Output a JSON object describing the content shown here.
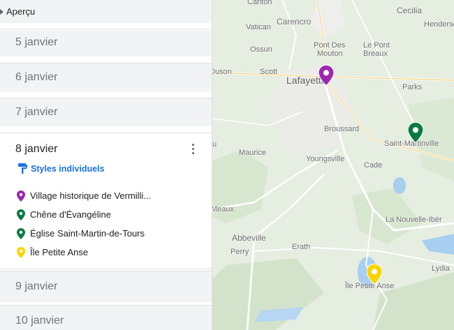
{
  "sidebar": {
    "overview_label": "Aperçu",
    "days_before": [
      "5 janvier",
      "6 janvier",
      "7 janvier"
    ],
    "expanded_day": {
      "title": "8 janvier",
      "style_link": "Styles individuels",
      "places": [
        {
          "name": "Village historique de Vermilli...",
          "color": "#9c27b0"
        },
        {
          "name": "Chêne d'Évangéline",
          "color": "#0b7a42"
        },
        {
          "name": "Église Saint-Martin-de-Tours",
          "color": "#0b7a42"
        },
        {
          "name": "Île Petite Anse",
          "color": "#fbd400"
        }
      ]
    },
    "days_after": [
      "9 janvier",
      "10 janvier"
    ]
  },
  "map": {
    "labels": {
      "carlton": "Carlton",
      "cecilia": "Cecilia",
      "carencro": "Carencro",
      "vatican": "Vatican",
      "henderson": "Henderso",
      "ossun": "Ossun",
      "pont_des_mouton_1": "Pont Des",
      "pont_des_mouton_2": "Mouton",
      "le_pont_breaux_1": "Le Pont",
      "le_pont_breaux_2": "Breaux",
      "duson": "Duson",
      "scott": "Scott",
      "lafayette": "Lafayette",
      "parks": "Parks",
      "broussard": "Broussard",
      "saint_martinville": "Saint-Martinville",
      "maurice": "Maurice",
      "youngsville": "Youngsville",
      "cade": "Cade",
      "meaux": "Meaux",
      "nouvelle_iberia": "La Nouvelle-Ibér",
      "abbeville": "Abbeville",
      "perry": "Perry",
      "erath": "Erath",
      "lydia": "Lydia",
      "ile_petite_anse": "Île Petite Anse",
      "edge_u": "u"
    },
    "pin_colors": {
      "purple": "#9c27b0",
      "green": "#0b7a42",
      "yellow": "#fbd400"
    }
  }
}
